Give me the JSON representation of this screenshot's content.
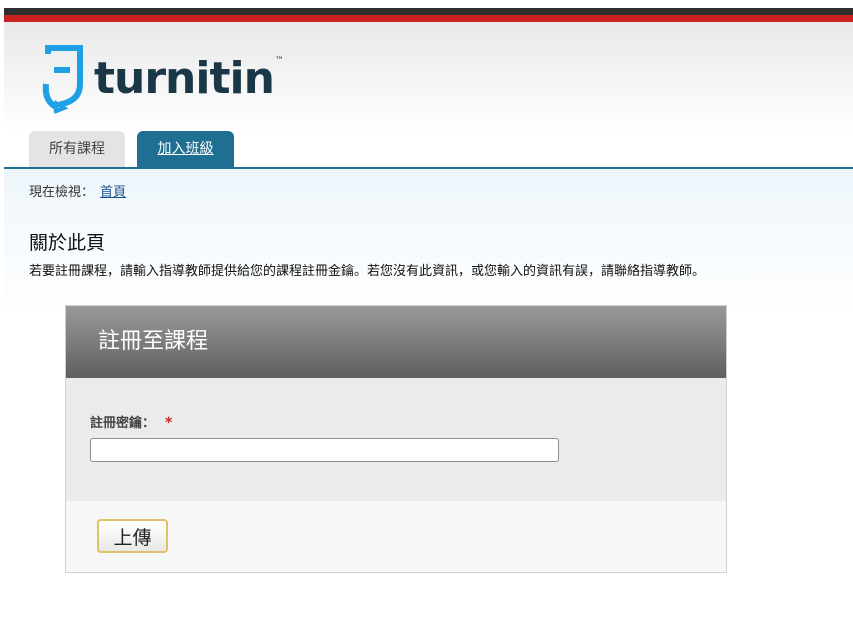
{
  "brand": {
    "name": "turnitin",
    "tm": "™",
    "text_color": "#1a3748",
    "mark_color": "#1ea0e6"
  },
  "colors": {
    "accent_blue": "#1f6f93",
    "stripe_red": "#cc1f1f",
    "stripe_dark": "#2e2e2e",
    "button_border": "#e0c16a"
  },
  "tabs": [
    {
      "label": "所有課程",
      "active": false
    },
    {
      "label": "加入班級",
      "active": true
    }
  ],
  "breadcrumb": {
    "prefix": "現在檢視：",
    "link": "首頁"
  },
  "about": {
    "title": "關於此頁",
    "description": "若要註冊課程，請輸入指導教師提供給您的課程註冊金鑰。若您沒有此資訊，或您輸入的資訊有誤，請聯絡指導教師。"
  },
  "enroll_panel": {
    "title": "註冊至課程",
    "field_label": "註冊密鑰：",
    "required_mark": "*",
    "field_value": "",
    "submit_label": "上傳"
  }
}
